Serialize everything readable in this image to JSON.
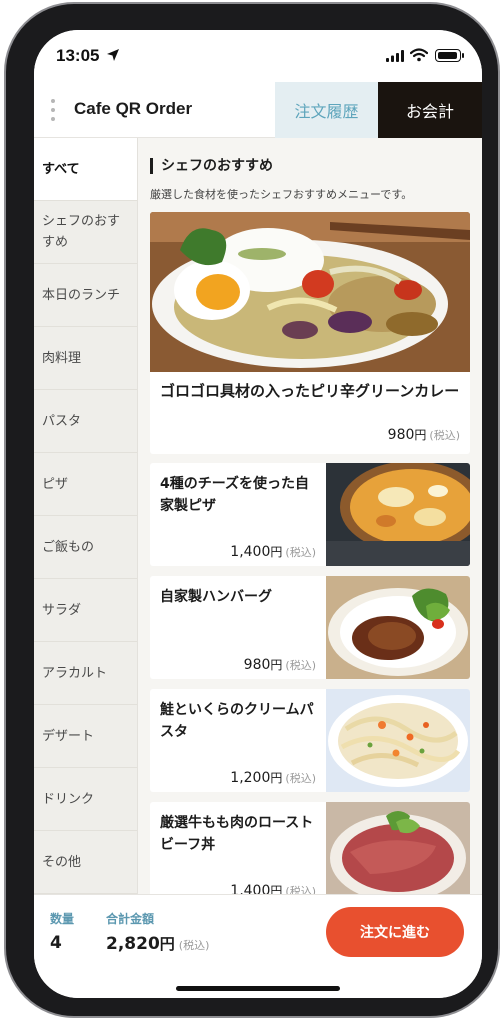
{
  "status": {
    "time": "13:05"
  },
  "header": {
    "brand": "Cafe QR Order",
    "history": "注文履歴",
    "checkout": "お会計"
  },
  "sidebar": {
    "items": [
      {
        "label": "すべて",
        "active": true
      },
      {
        "label": "シェフのおすすめ"
      },
      {
        "label": "本日のランチ"
      },
      {
        "label": "肉料理"
      },
      {
        "label": "パスタ"
      },
      {
        "label": "ピザ"
      },
      {
        "label": "ご飯もの"
      },
      {
        "label": "サラダ"
      },
      {
        "label": "アラカルト"
      },
      {
        "label": "デザート"
      },
      {
        "label": "ドリンク"
      },
      {
        "label": "その他"
      }
    ]
  },
  "section": {
    "title": "シェフのおすすめ",
    "description": "厳選した食材を使ったシェフおすすめメニューです。"
  },
  "products": [
    {
      "name": "ゴロゴロ具材の入ったピリ辛グリーンカレー",
      "price": "980",
      "unit": "円",
      "tax": "(税込)"
    },
    {
      "name": "4種のチーズを使った自家製ピザ",
      "price": "1,400",
      "unit": "円",
      "tax": "(税込)"
    },
    {
      "name": "自家製ハンバーグ",
      "price": "980",
      "unit": "円",
      "tax": "(税込)"
    },
    {
      "name": "鮭といくらのクリームパスタ",
      "price": "1,200",
      "unit": "円",
      "tax": "(税込)"
    },
    {
      "name": "厳選牛もも肉のローストビーフ丼",
      "price": "1,400",
      "unit": "円",
      "tax": "(税込)"
    }
  ],
  "footer": {
    "qty_label": "数量",
    "qty": "4",
    "total_label": "合計金額",
    "total": "2,820",
    "unit": "円",
    "tax": "(税込)",
    "order_button": "注文に進む"
  },
  "colors": {
    "accent": "#e8502f",
    "checkout_bg": "#1a140f",
    "history_bg": "#e4eef2",
    "label_blue": "#5c98b0"
  }
}
